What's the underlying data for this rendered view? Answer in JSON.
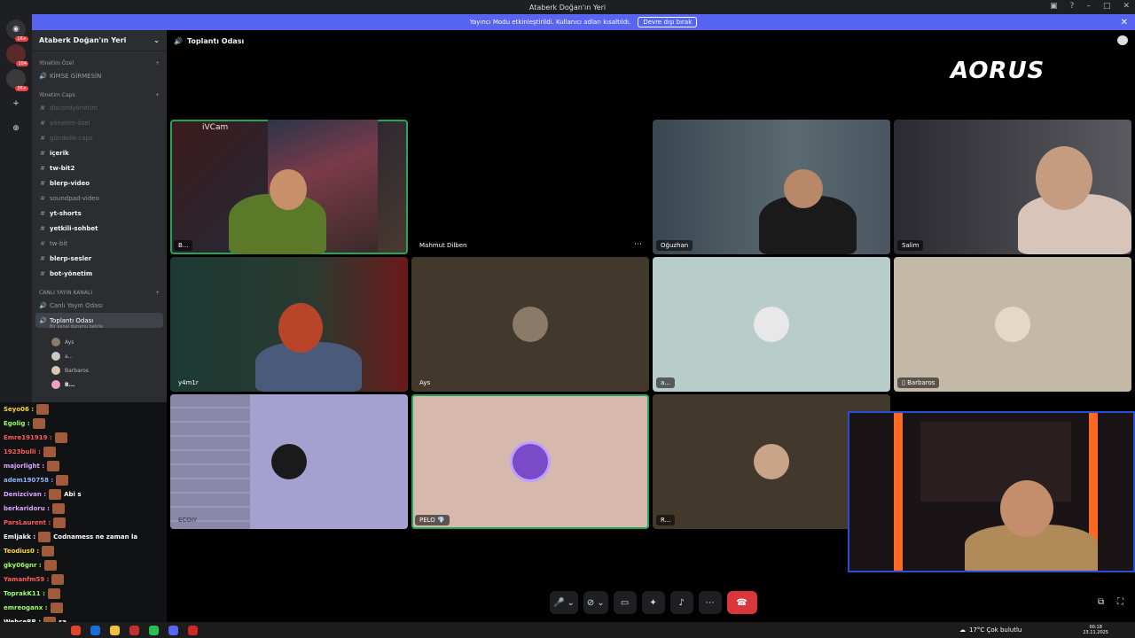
{
  "window": {
    "title": "Ataberk Doğan'ın Yeri"
  },
  "banner": {
    "text": "Yayıncı Modu etkinleştirildi. Kullanıcı adları kısaltıldı.",
    "button": "Devre dışı bırak"
  },
  "servers": {
    "badges": [
      "1K+",
      "104",
      "3K+"
    ]
  },
  "sidebar": {
    "guild_name": "Ataberk Doğan'ın Yeri",
    "cat1": "Yönetim Özel",
    "ch_kimse": "KİMSE GİRMESİN",
    "cat2": "Yönetim Caps",
    "channels": [
      {
        "label": "discordyönetim"
      },
      {
        "label": "yönetim-özel"
      },
      {
        "label": "gündelik-caps"
      },
      {
        "label": "içerik"
      },
      {
        "label": "tw-bit2"
      },
      {
        "label": "blerp-video"
      },
      {
        "label": "soundpad-video"
      },
      {
        "label": "yt-shorts"
      },
      {
        "label": "yetkili-sohbet"
      },
      {
        "label": "tw-bit"
      },
      {
        "label": "blerp-sesler"
      },
      {
        "label": "bot-yönetim"
      }
    ],
    "cat3": "CANLI YAYIN KANALI",
    "voice1": "Canlı Yayın Odası",
    "voice2": "Toplantı Odası",
    "voice2_sub": "Bir kanal durumu belirle",
    "voice_users": [
      "Ays",
      "a...",
      "Barbaros",
      "B..."
    ]
  },
  "chat_overlay": [
    {
      "user": "Seyo06 :",
      "msg": "",
      "color": "#f9d44a"
    },
    {
      "user": "Egolig :",
      "msg": "",
      "color": "#9efc71"
    },
    {
      "user": "Emre191919 :",
      "msg": "",
      "color": "#ff5b5b"
    },
    {
      "user": "1923bulli :",
      "msg": "",
      "color": "#ff5b5b"
    },
    {
      "user": "majorlight :",
      "msg": "",
      "color": "#d6a7ff"
    },
    {
      "user": "adem190758 :",
      "msg": "",
      "color": "#8fb3ff"
    },
    {
      "user": "Denizcivan :",
      "msg": "Abi s",
      "color": "#d6a7ff"
    },
    {
      "user": "berkaridoru :",
      "msg": "",
      "color": "#d6a7ff"
    },
    {
      "user": "ParsLaurent :",
      "msg": "",
      "color": "#ff5b5b"
    },
    {
      "user": "Emljakk :",
      "msg": "Codnamess ne zaman la",
      "color": "#ffffff"
    },
    {
      "user": "Teodius0 :",
      "msg": "",
      "color": "#f9d44a"
    },
    {
      "user": "gky06gnr :",
      "msg": "",
      "color": "#9efc71"
    },
    {
      "user": "Yamanfm59 :",
      "msg": "",
      "color": "#ff5b5b"
    },
    {
      "user": "ToprakK11 :",
      "msg": "",
      "color": "#9efc71"
    },
    {
      "user": "emreoganx :",
      "msg": "",
      "color": "#9efc71"
    },
    {
      "user": "WehceRR :",
      "msg": "sa",
      "color": "#ffffff"
    }
  ],
  "topbar": {
    "channel": "Toplantı Odası"
  },
  "brand": {
    "logo": "AORUS"
  },
  "tiles": [
    {
      "name": "B...",
      "label_top": "iVCam"
    },
    {
      "name": "Mahmut Dilben"
    },
    {
      "name": "Oğuzhan"
    },
    {
      "name": "Salim"
    },
    {
      "name": "y4m1r"
    },
    {
      "name": "Ays"
    },
    {
      "name": "a..."
    },
    {
      "name": "Barbaros"
    },
    {
      "name": "ECOIY"
    },
    {
      "name": "PELO 💎"
    },
    {
      "name": "R..."
    }
  ],
  "taskbar": {
    "weather": "17°C  Çok bulutlu",
    "time": "00:18",
    "date": "23.11.2025"
  }
}
